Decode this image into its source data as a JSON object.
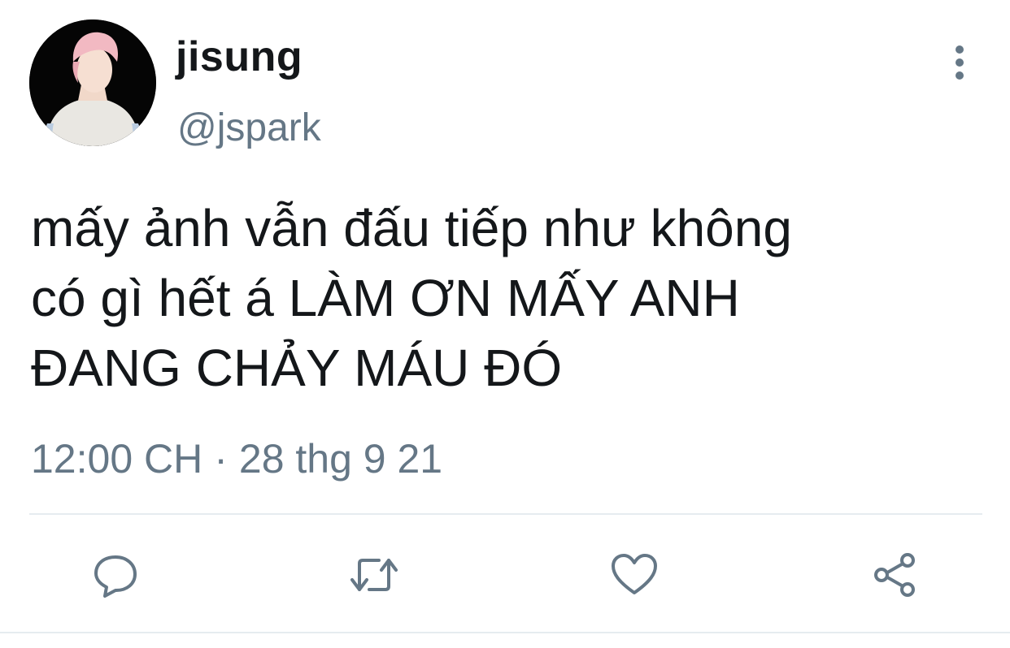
{
  "user": {
    "display_name": "jisung",
    "handle": "@jspark",
    "avatar_icon": "profile-photo"
  },
  "tweet": {
    "lines": [
      "mấy ảnh vẫn đấu tiếp như không",
      "có gì hết á LÀM ƠN MẤY ANH",
      "ĐANG CHẢY MÁU ĐÓ"
    ],
    "time": "12:00 CH",
    "separator": "·",
    "date": "28 thg 9 21"
  },
  "actions": {
    "icons": [
      "reply-icon",
      "retweet-icon",
      "like-icon",
      "share-icon"
    ],
    "more_icon": "more-vertical-icon"
  },
  "colors": {
    "text": "#14171a",
    "secondary": "#657786",
    "divider": "#e6ecf0",
    "background": "#ffffff"
  }
}
